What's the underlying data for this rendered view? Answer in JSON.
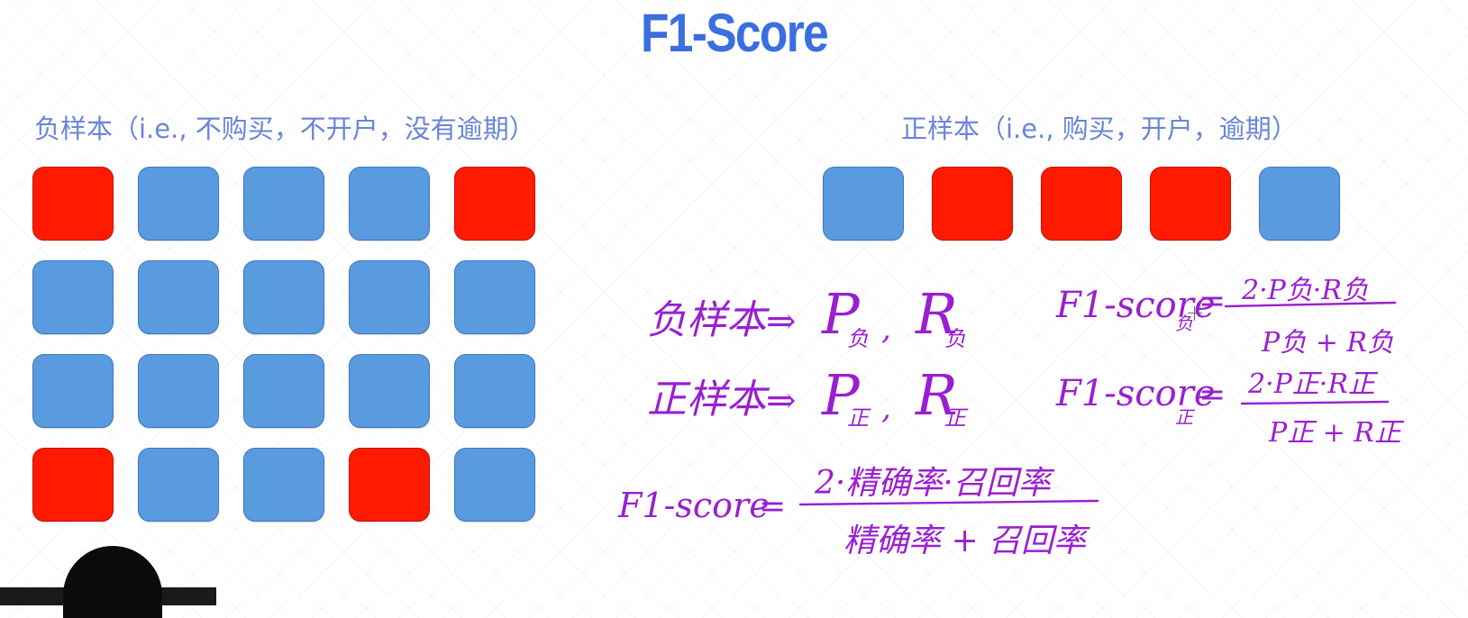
{
  "slide": {
    "title": "F1-Score"
  },
  "negative_samples": {
    "caption": "负样本（i.e., 不购买，不开户，没有逾期）",
    "grid": [
      [
        "red",
        "blue",
        "blue",
        "blue",
        "red"
      ],
      [
        "blue",
        "blue",
        "blue",
        "blue",
        "blue"
      ],
      [
        "blue",
        "blue",
        "blue",
        "blue",
        "blue"
      ],
      [
        "red",
        "blue",
        "blue",
        "red",
        "blue"
      ]
    ]
  },
  "positive_samples": {
    "caption": "正样本（i.e., 购买，开户，逾期）",
    "row": [
      "blue",
      "red",
      "red",
      "red",
      "blue"
    ]
  },
  "colors": {
    "red": "#ff1a00",
    "blue": "#5a9ade",
    "title": "#3b6fe0",
    "caption": "#6a85d8",
    "ink": "#9a1fd0"
  },
  "handwriting": {
    "neg_line": {
      "label": "负样本",
      "arrow": "⇒",
      "p": "P",
      "p_sub": "负",
      "comma": ",",
      "r": "R",
      "r_sub": "负"
    },
    "pos_line": {
      "label": "正样本",
      "arrow": "⇒",
      "p": "P",
      "p_sub": "正",
      "comma": ",",
      "r": "R",
      "r_sub": "正"
    },
    "f1_neg": {
      "lhs": "F1-score",
      "lhs_sub": "负",
      "eq": "=",
      "numerator": "2·P负·R负",
      "denominator": "P负 + R负"
    },
    "f1_pos": {
      "lhs": "F1-score",
      "lhs_sub": "正",
      "eq": "=",
      "numerator": "2·P正·R正",
      "denominator": "P正 + R正"
    },
    "f1_general": {
      "lhs": "F1-score",
      "eq": "=",
      "numerator": "2·精确率·召回率",
      "denominator": "精确率 + 召回率"
    }
  }
}
